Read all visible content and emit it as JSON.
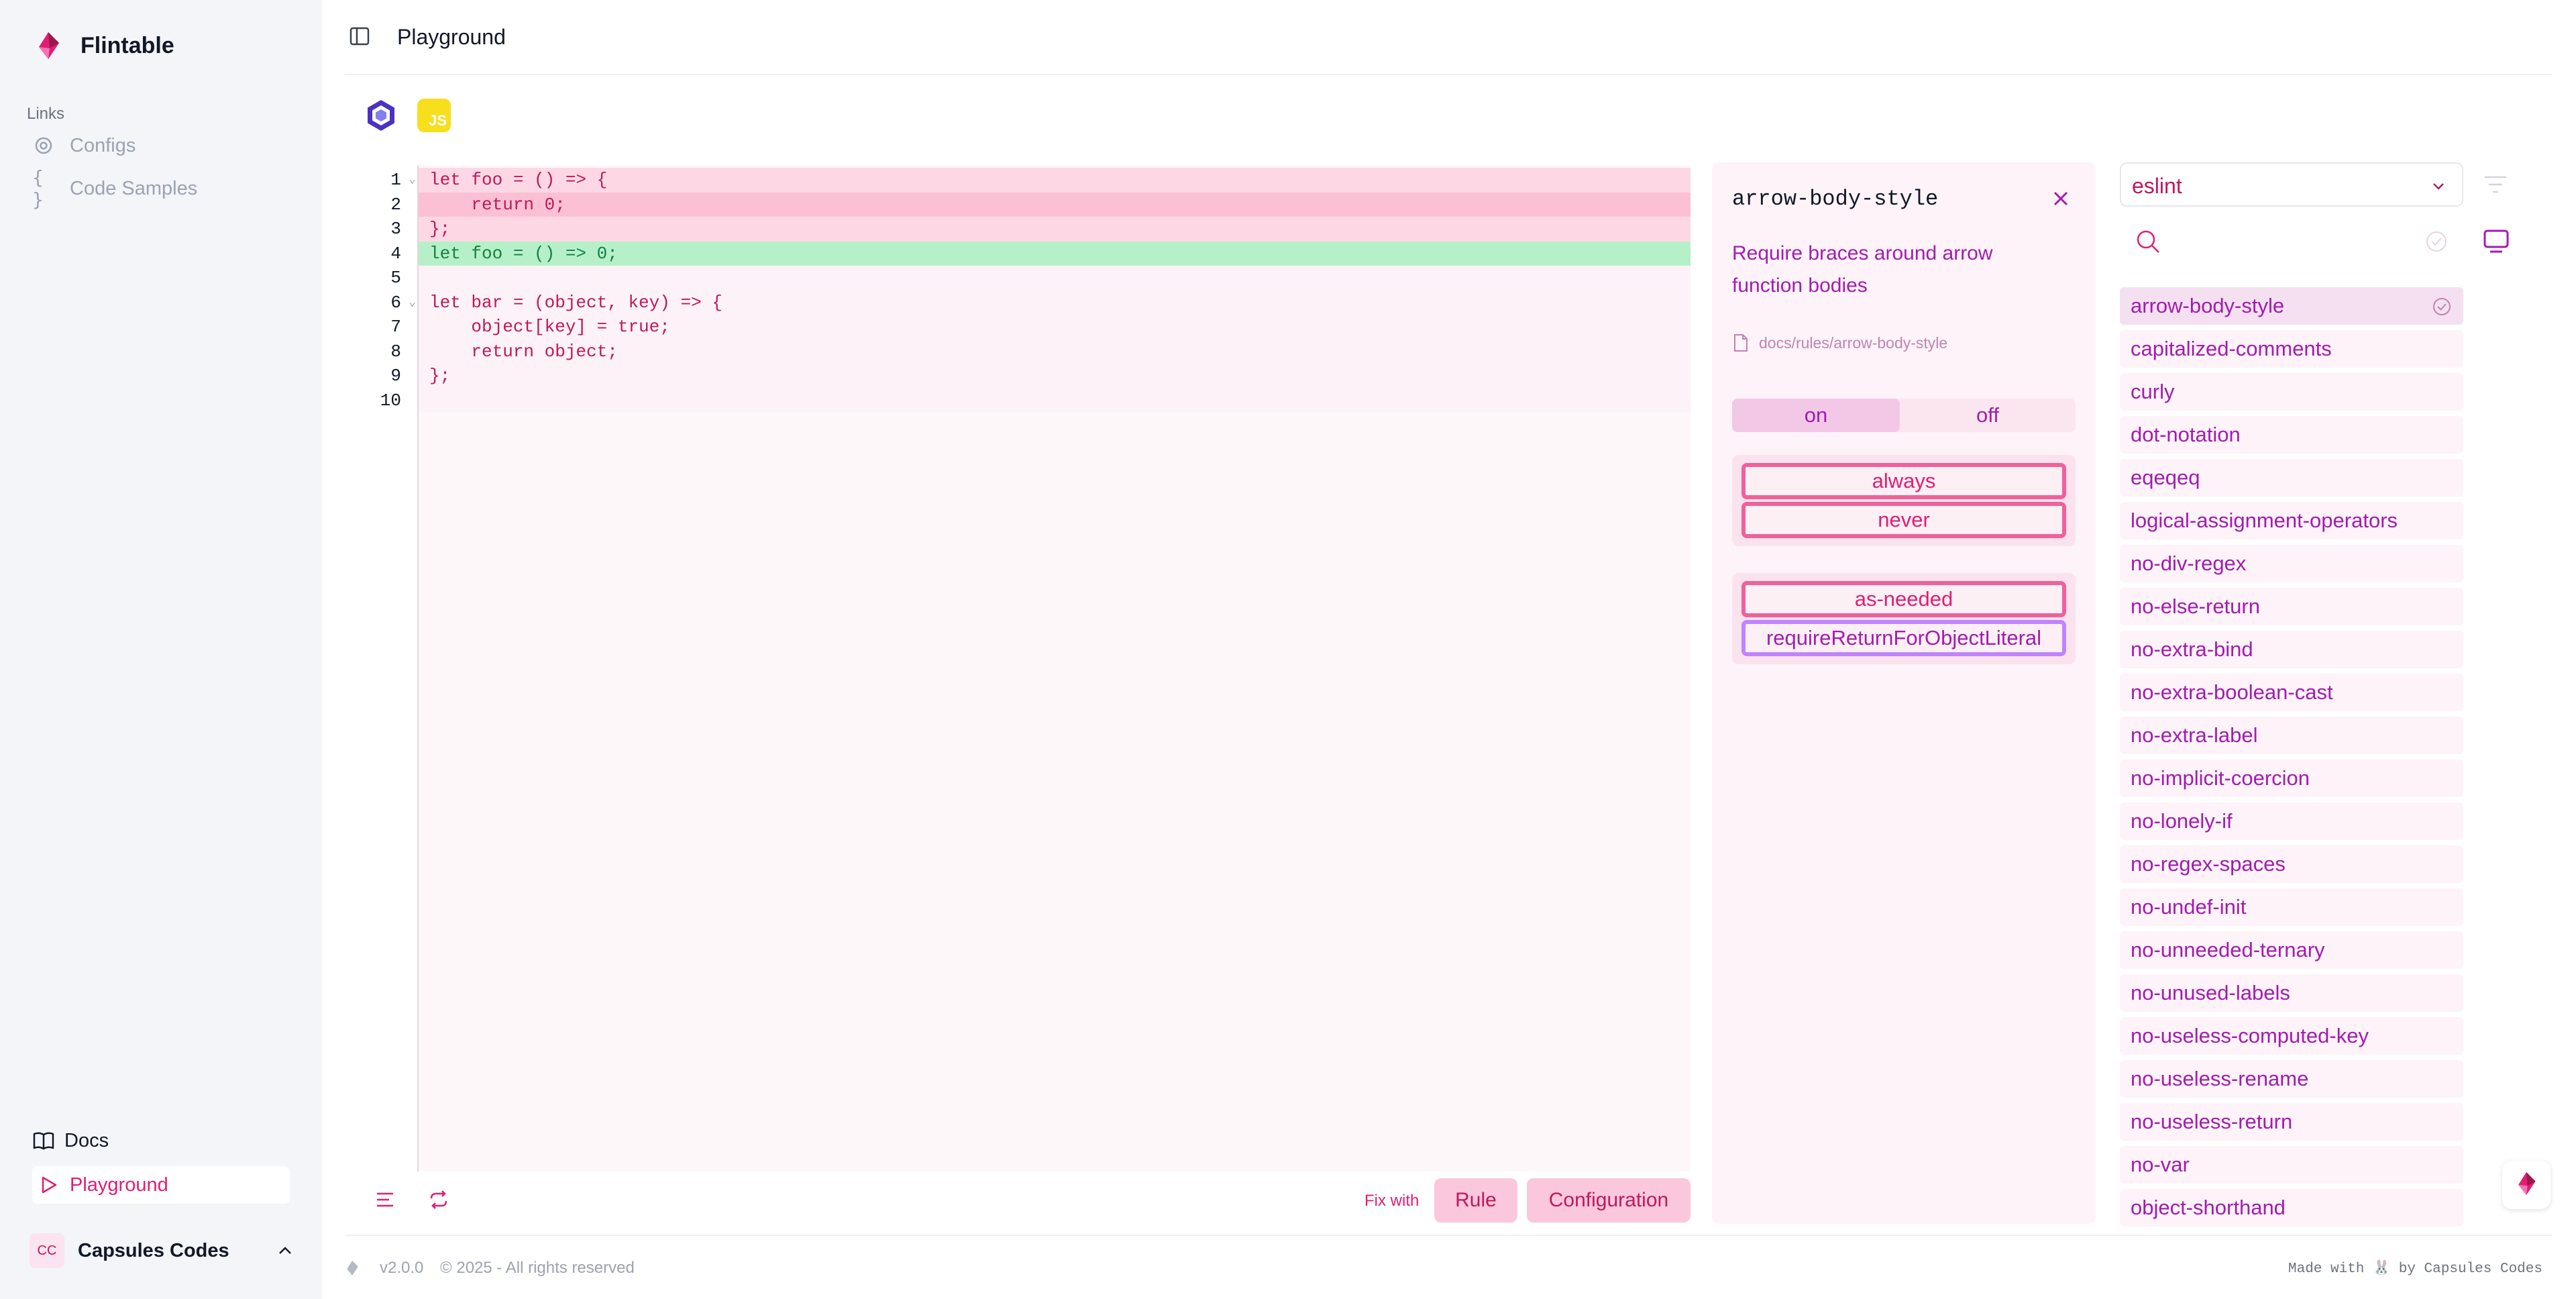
{
  "app": {
    "name": "Flintable"
  },
  "sidebar": {
    "section_label": "Links",
    "links": [
      {
        "label": "Configs",
        "icon": "gear-icon"
      },
      {
        "label": "Code Samples",
        "icon": "braces-icon"
      }
    ],
    "bottom_links": [
      {
        "label": "Docs",
        "icon": "book-icon"
      },
      {
        "label": "Playground",
        "icon": "play-icon"
      }
    ],
    "user": {
      "initials": "CC",
      "name": "Capsules Codes"
    }
  },
  "header": {
    "title": "Playground"
  },
  "frameworks": {
    "js_badge": "JS"
  },
  "editor": {
    "lines": [
      {
        "num": "1",
        "text": "let foo = () => {",
        "style": "del1",
        "fold": true
      },
      {
        "num": "2",
        "text": "    return 0;",
        "style": "del2",
        "fold": false
      },
      {
        "num": "3",
        "text": "};",
        "style": "del1",
        "fold": false
      },
      {
        "num": "4",
        "text": "let foo = () => 0;",
        "style": "add",
        "fold": false
      },
      {
        "num": "5",
        "text": "",
        "style": "plain",
        "fold": false
      },
      {
        "num": "6",
        "text": "let bar = (object, key) => {",
        "style": "plain",
        "fold": true
      },
      {
        "num": "7",
        "text": "    object[key] = true;",
        "style": "plain",
        "fold": false
      },
      {
        "num": "8",
        "text": "    return object;",
        "style": "plain",
        "fold": false
      },
      {
        "num": "9",
        "text": "};",
        "style": "plain",
        "fold": false
      },
      {
        "num": "10",
        "text": "",
        "style": "empty",
        "fold": false
      }
    ],
    "fix_with_label": "Fix with",
    "rule_button": "Rule",
    "configuration_button": "Configuration"
  },
  "rule_panel": {
    "title": "arrow-body-style",
    "description": "Require braces around arrow function bodies",
    "doc_link": "docs/rules/arrow-body-style",
    "toggle_on": "on",
    "toggle_off": "off",
    "options_group_1": [
      "always",
      "never"
    ],
    "options_group_2": [
      "as-needed",
      "requireReturnForObjectLiteral"
    ]
  },
  "rules_list": {
    "linter": "eslint",
    "search_placeholder": "",
    "items": [
      "arrow-body-style",
      "capitalized-comments",
      "curly",
      "dot-notation",
      "eqeqeq",
      "logical-assignment-operators",
      "no-div-regex",
      "no-else-return",
      "no-extra-bind",
      "no-extra-boolean-cast",
      "no-extra-label",
      "no-implicit-coercion",
      "no-lonely-if",
      "no-regex-spaces",
      "no-undef-init",
      "no-unneeded-ternary",
      "no-unused-labels",
      "no-useless-computed-key",
      "no-useless-rename",
      "no-useless-return",
      "no-var",
      "object-shorthand"
    ],
    "active_index": 0
  },
  "footer": {
    "version": "v2.0.0",
    "copyright": "© 2025 - All rights reserved",
    "made_with": "Made with 🐰 by Capsules Codes"
  },
  "colors": {
    "accent": "#e11d74",
    "accent_purple": "#a21caf",
    "deleted_line": "#fdd8e4",
    "added_line": "#b6f0c8"
  }
}
